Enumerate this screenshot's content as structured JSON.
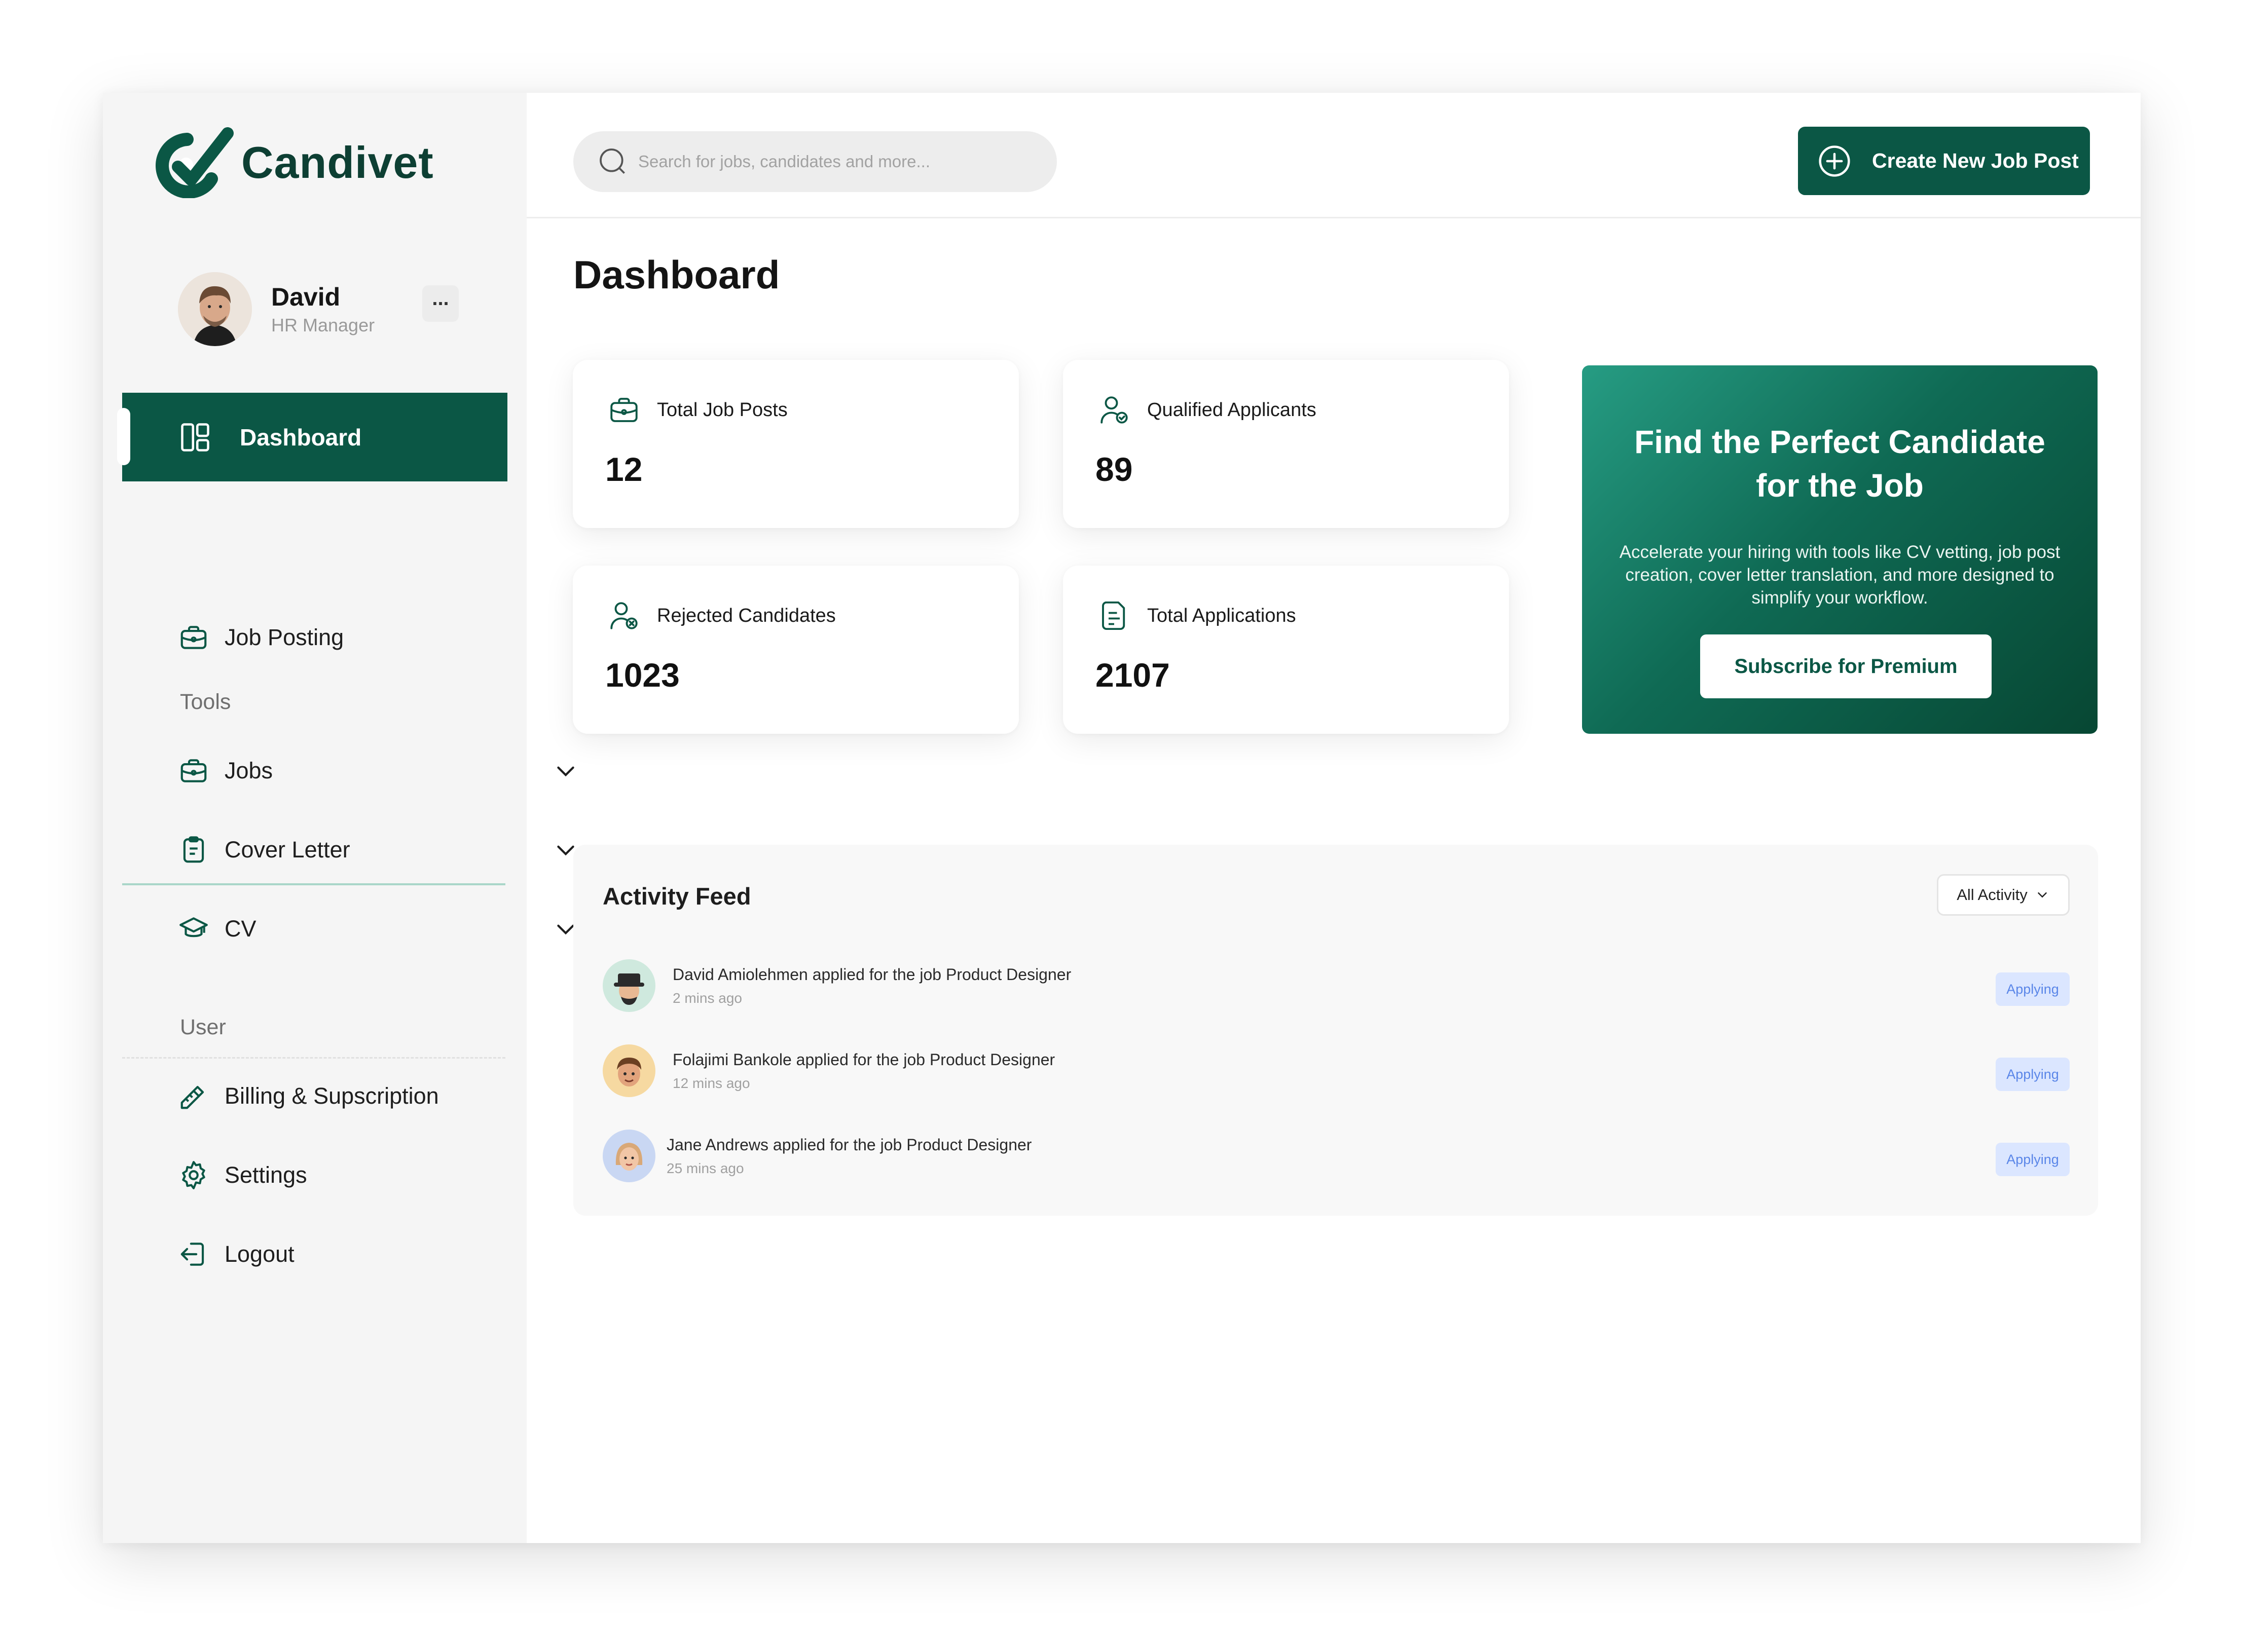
{
  "app": {
    "name": "Candivet",
    "brand_color": "#0b5745"
  },
  "user": {
    "name": "David",
    "role": "HR Manager",
    "more_icon": "ellipsis-icon",
    "more_label": "..."
  },
  "sidebar": {
    "active": {
      "label": "Dashboard",
      "icon": "dashboard-icon"
    },
    "job_posting": {
      "label": "Job Posting",
      "icon": "briefcase-icon"
    },
    "tools_heading": "Tools",
    "tools": [
      {
        "label": "Jobs",
        "icon": "briefcase-icon"
      },
      {
        "label": "Cover Letter",
        "icon": "clipboard-icon"
      },
      {
        "label": "CV",
        "icon": "graduation-cap-icon"
      }
    ],
    "user_heading": "User",
    "user_items": [
      {
        "label": "Billing & Supscription",
        "icon": "pencil-ruler-icon"
      },
      {
        "label": "Settings",
        "icon": "gear-icon"
      },
      {
        "label": "Logout",
        "icon": "logout-icon"
      }
    ]
  },
  "topbar": {
    "search_placeholder": "Search for jobs, candidates and more...",
    "create_button": "Create New Job Post"
  },
  "page": {
    "title": "Dashboard"
  },
  "stats": [
    {
      "label": "Total Job Posts",
      "value": "12",
      "icon": "briefcase-icon"
    },
    {
      "label": "Qualified Applicants",
      "value": "89",
      "icon": "user-check-icon"
    },
    {
      "label": "Rejected Candidates",
      "value": "1023",
      "icon": "user-x-icon"
    },
    {
      "label": "Total Applications",
      "value": "2107",
      "icon": "document-icon"
    }
  ],
  "promo": {
    "title": "Find the Perfect Candidate for the Job",
    "body": "Accelerate your hiring with tools like CV vetting, job post creation, cover letter translation, and more designed to simplify your workflow.",
    "button": "Subscribe for Premium"
  },
  "feed": {
    "title": "Activity Feed",
    "filter": "All Activity",
    "items": [
      {
        "text": "David Amiolehmen applied for the job Product Designer",
        "time": "2 mins ago",
        "status": "Applying",
        "avatar_bg": "#cfe9de"
      },
      {
        "text": "Folajimi Bankole applied for the job Product Designer",
        "time": "12 mins ago",
        "status": "Applying",
        "avatar_bg": "#f6d9a1"
      },
      {
        "text": "Jane Andrews applied for the job Product Designer",
        "time": "25 mins ago",
        "status": "Applying",
        "avatar_bg": "#c9d7f3"
      }
    ]
  }
}
